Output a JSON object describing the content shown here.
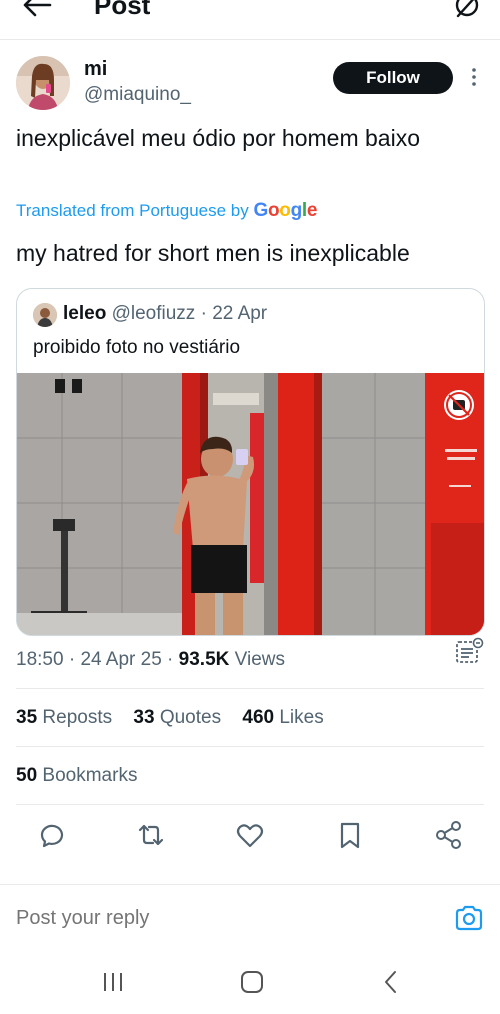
{
  "header": {
    "title": "Post",
    "back_icon": "arrow-left-icon",
    "right_icon": "grok-icon"
  },
  "post": {
    "author_name": "mi",
    "author_handle": "@miaquino_",
    "follow_label": "Follow",
    "text": "inexplicável meu ódio por homem baixo",
    "translated_prefix": "Translated from Portuguese by",
    "translated_brand": "Google",
    "translation": "my hatred for short men is inexplicable"
  },
  "quote": {
    "name": "leleo",
    "handle": "@leofiuzz",
    "separator": " · ",
    "date": "22 Apr",
    "text": "proibido foto no vestiário"
  },
  "meta": {
    "time": "18:50",
    "date": "24 Apr 25",
    "separator": " · ",
    "views_count": "93.5K",
    "views_label": "Views"
  },
  "stats": {
    "reposts_count": "35",
    "reposts_label": "Reposts",
    "quotes_count": "33",
    "quotes_label": "Quotes",
    "likes_count": "460",
    "likes_label": "Likes",
    "bookmarks_count": "50",
    "bookmarks_label": "Bookmarks"
  },
  "actions": [
    "reply-icon",
    "repost-icon",
    "like-icon",
    "bookmark-icon",
    "share-icon"
  ],
  "reply": {
    "placeholder": "Post your reply"
  },
  "colors": {
    "accent": "#1d9bf0",
    "text": "#0f1419",
    "muted": "#536471",
    "border": "#e7e9ea",
    "locker_red": "#e0251b"
  }
}
